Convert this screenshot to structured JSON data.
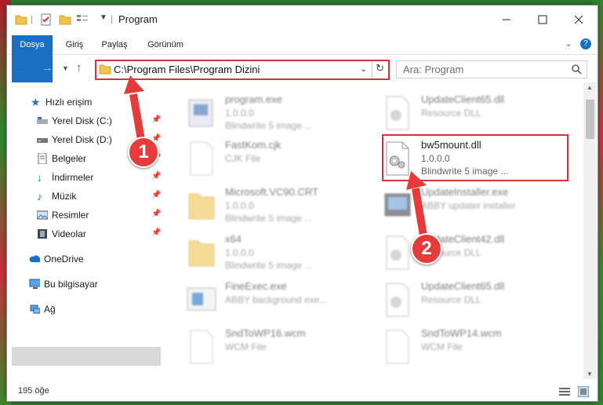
{
  "window": {
    "title": "Program"
  },
  "ribbon": {
    "tabs": [
      "Dosya",
      "Giriş",
      "Paylaş",
      "Görünüm"
    ]
  },
  "address": {
    "path": "C:\\Program Files\\Program Dizini"
  },
  "search": {
    "placeholder": "Ara: Program"
  },
  "sidebar": {
    "quick_access": "Hızlı erişim",
    "items": [
      "Yerel Disk (C:)",
      "Yerel Disk (D:)",
      "Belgeler",
      "İndirmeler",
      "Müzik",
      "Resimler",
      "Videolar"
    ],
    "onedrive": "OneDrive",
    "this_pc": "Bu bilgisayar",
    "network": "Ağ"
  },
  "files": [
    {
      "name": "program.exe",
      "version": "1.0.0.0",
      "desc": "Blindwrite 5 image ..."
    },
    {
      "name": "UpdateClient65.dll",
      "version": "",
      "desc": "Resource DLL"
    },
    {
      "name": "FastKom.cjk",
      "version": "",
      "desc": "CJK File"
    },
    {
      "name": "bw5mount.dll",
      "version": "1.0.0.0",
      "desc": "Blindwrite 5 image ..."
    },
    {
      "name": "Microsoft.VC90.CRT",
      "version": "1.0.0.0",
      "desc": "Blindwrite 5 image ..."
    },
    {
      "name": "UpdateInstaller.exe",
      "version": "",
      "desc": "ABBY updater installer"
    },
    {
      "name": "x64",
      "version": "1.0.0.0",
      "desc": "Blindwrite 5 image ..."
    },
    {
      "name": "UpdateClient42.dll",
      "version": "",
      "desc": "Resource DLL"
    },
    {
      "name": "FineExec.exe",
      "version": "",
      "desc": "ABBY background exe..."
    },
    {
      "name": "UpdateClient65.dll",
      "version": "",
      "desc": "Resource DLL"
    },
    {
      "name": "SndToWP16.wcm",
      "version": "",
      "desc": "WCM File"
    },
    {
      "name": "SndToWP14.wcm",
      "version": "",
      "desc": "WCM File"
    }
  ],
  "status": {
    "count": "195 öğe"
  },
  "annotations": [
    "1",
    "2"
  ],
  "colors": {
    "accent": "#1a6fc4",
    "highlight": "#d9313b",
    "marker": "#e53b3b"
  }
}
